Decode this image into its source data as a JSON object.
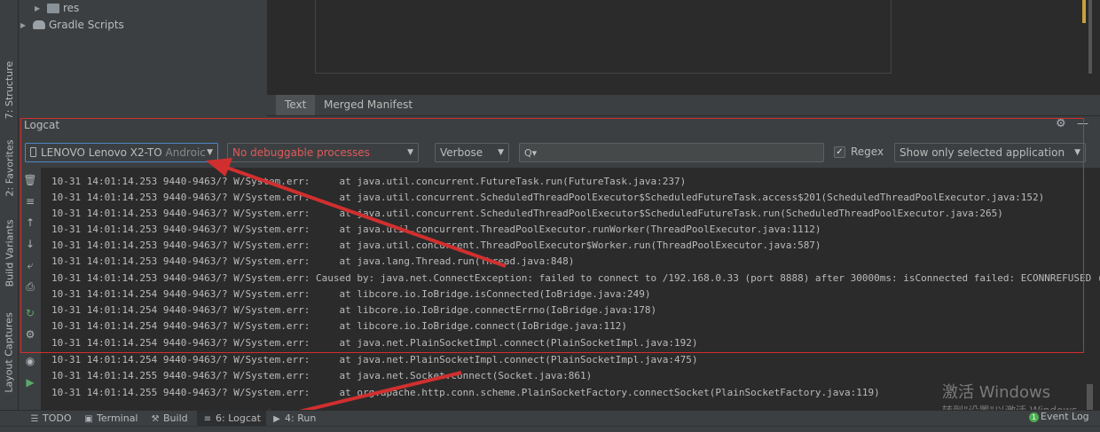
{
  "left_strip": {
    "structure_label": "7: Structure",
    "favorites_label": "2: Favorites",
    "build_variants_label": "Build Variants",
    "layout_captures_label": "Layout Captures"
  },
  "project_tree": {
    "items": [
      {
        "label": "res",
        "icon": "folder-icon"
      },
      {
        "label": "Gradle Scripts",
        "icon": "gradle-icon"
      }
    ]
  },
  "editor_tabs": [
    "Text",
    "Merged Manifest"
  ],
  "logcat": {
    "title": "Logcat",
    "device": "LENOVO Lenovo X2-TO",
    "device_suffix": "Androic",
    "process": "No debuggable processes",
    "level": "Verbose",
    "search_icon": "Q▾",
    "regex_checked": true,
    "regex_label": "Regex",
    "filter": "Show only selected application",
    "lines": [
      "10-31 14:01:14.253 9440-9463/? W/System.err:     at java.util.concurrent.FutureTask.run(FutureTask.java:237)",
      "10-31 14:01:14.253 9440-9463/? W/System.err:     at java.util.concurrent.ScheduledThreadPoolExecutor$ScheduledFutureTask.access$201(ScheduledThreadPoolExecutor.java:152)",
      "10-31 14:01:14.253 9440-9463/? W/System.err:     at java.util.concurrent.ScheduledThreadPoolExecutor$ScheduledFutureTask.run(ScheduledThreadPoolExecutor.java:265)",
      "10-31 14:01:14.253 9440-9463/? W/System.err:     at java.util.concurrent.ThreadPoolExecutor.runWorker(ThreadPoolExecutor.java:1112)",
      "10-31 14:01:14.253 9440-9463/? W/System.err:     at java.util.concurrent.ThreadPoolExecutor$Worker.run(ThreadPoolExecutor.java:587)",
      "10-31 14:01:14.253 9440-9463/? W/System.err:     at java.lang.Thread.run(Thread.java:848)",
      "10-31 14:01:14.253 9440-9463/? W/System.err: Caused by: java.net.ConnectException: failed to connect to /192.168.0.33 (port 8888) after 30000ms: isConnected failed: ECONNREFUSED (Conn",
      "10-31 14:01:14.254 9440-9463/? W/System.err:     at libcore.io.IoBridge.isConnected(IoBridge.java:249)",
      "10-31 14:01:14.254 9440-9463/? W/System.err:     at libcore.io.IoBridge.connectErrno(IoBridge.java:178)",
      "10-31 14:01:14.254 9440-9463/? W/System.err:     at libcore.io.IoBridge.connect(IoBridge.java:112)",
      "10-31 14:01:14.254 9440-9463/? W/System.err:     at java.net.PlainSocketImpl.connect(PlainSocketImpl.java:192)",
      "10-31 14:01:14.254 9440-9463/? W/System.err:     at java.net.PlainSocketImpl.connect(PlainSocketImpl.java:475)",
      "10-31 14:01:14.255 9440-9463/? W/System.err:     at java.net.Socket.connect(Socket.java:861)",
      "10-31 14:01:14.255 9440-9463/? W/System.err:     at org.apache.http.conn.scheme.PlainSocketFactory.connectSocket(PlainSocketFactory.java:119)"
    ]
  },
  "bottom_tabs": [
    {
      "label": "TODO",
      "icon": "list-icon"
    },
    {
      "label": "Terminal",
      "icon": "terminal-icon"
    },
    {
      "label": "Build",
      "icon": "hammer-icon"
    },
    {
      "label": "6: Logcat",
      "icon": "logcat-icon",
      "active": true
    },
    {
      "label": "4: Run",
      "icon": "run-icon"
    }
  ],
  "event_log": {
    "label": "Event Log",
    "badge": "1"
  },
  "watermark": {
    "title": "激活 Windows",
    "subtitle": "转到\"设置\"以激活 Windows。"
  },
  "colors": {
    "annotation_red": "#d12f2f",
    "process_error": "#e05a5a",
    "focus_blue": "#4a88c7"
  }
}
